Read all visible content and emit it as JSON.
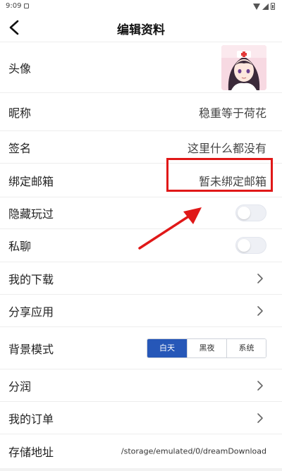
{
  "status_bar": {
    "time": "9:09"
  },
  "header": {
    "title": "编辑资料"
  },
  "rows": {
    "avatar": {
      "label": "头像"
    },
    "nickname": {
      "label": "昵称",
      "value": "稳重等于荷花"
    },
    "signature": {
      "label": "签名",
      "value": "这里什么都没有"
    },
    "email": {
      "label": "绑定邮箱",
      "value": "暂未绑定邮箱"
    },
    "hide_played": {
      "label": "隐藏玩过",
      "toggle_on": false
    },
    "private_chat": {
      "label": "私聊",
      "toggle_on": false
    },
    "my_downloads": {
      "label": "我的下载"
    },
    "share_app": {
      "label": "分享应用"
    },
    "background_mode": {
      "label": "背景模式",
      "options": [
        "白天",
        "黑夜",
        "系统"
      ],
      "selected": "白天"
    },
    "revenue_share": {
      "label": "分润"
    },
    "my_orders": {
      "label": "我的订单"
    },
    "storage_path": {
      "label": "存储地址",
      "value": "/storage/emulated/0/dreamDownload"
    }
  },
  "colors": {
    "accent": "#2657b8",
    "annotation": "#e01818"
  }
}
